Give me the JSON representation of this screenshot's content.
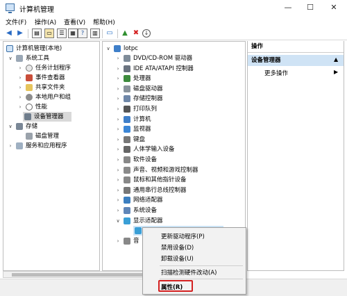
{
  "window": {
    "title": "计算机管理",
    "minimize": "—",
    "maximize": "☐",
    "close": "✕"
  },
  "menu": [
    "文件(F)",
    "操作(A)",
    "查看(V)",
    "帮助(H)"
  ],
  "toolbar": {
    "help_label": "?"
  },
  "left_tree": {
    "root": "计算机管理(本地)",
    "system_tools": "系统工具",
    "system_children": [
      "任务计划程序",
      "事件查看器",
      "共享文件夹",
      "本地用户和组",
      "性能",
      "设备管理器"
    ],
    "storage": "存储",
    "storage_children": [
      "磁盘管理"
    ],
    "services": "服务和应用程序"
  },
  "device_tree": {
    "root": "lotpc",
    "items": [
      "DVD/CD-ROM 驱动器",
      "IDE ATA/ATAPI 控制器",
      "处理器",
      "磁盘驱动器",
      "存储控制器",
      "打印队列",
      "计算机",
      "监视器",
      "键盘",
      "人体学输入设备",
      "软件设备",
      "声音、视频和游戏控制器",
      "鼠标和其他指针设备",
      "通用串行总线控制器",
      "网络适配器",
      "系统设备",
      "显示适配器"
    ],
    "partial_item": "音"
  },
  "actions": {
    "header": "操作",
    "title": "设备管理器",
    "more": "更多操作"
  },
  "context_menu": {
    "items": [
      "更新驱动程序(P)",
      "禁用设备(D)",
      "卸载设备(U)",
      "扫描检测硬件改动(A)",
      "属性(R)"
    ]
  }
}
